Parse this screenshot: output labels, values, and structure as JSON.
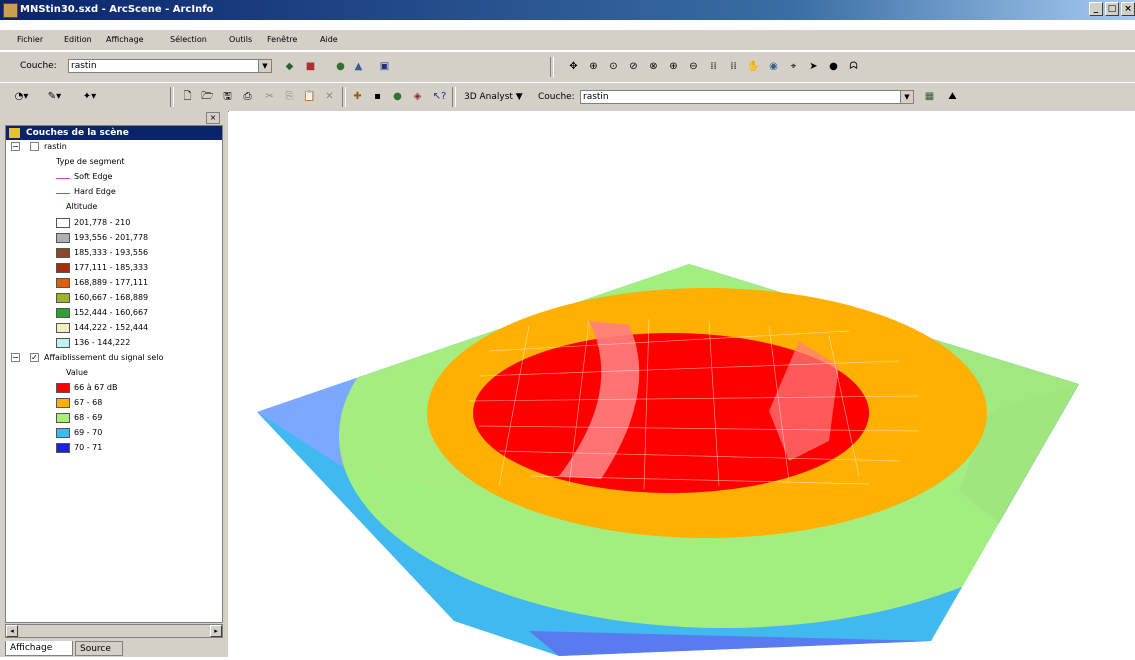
{
  "window": {
    "title": "MNStin30.sxd - ArcScene - ArcInfo",
    "min": "_",
    "max": "□",
    "close": "×"
  },
  "menu": [
    "Fichier",
    "Edition",
    "Affichage",
    "Sélection",
    "Outils",
    "Fenêtre",
    "Aide"
  ],
  "toolbar": {
    "layer_label": "Couche:",
    "layer_value": "rastin",
    "analyst_label": "3D Analyst ▼",
    "layer_label2": "Couche:",
    "layer_value2": "rastin"
  },
  "toc": {
    "title": "Couches de la scène",
    "layer1": {
      "name": "rastin",
      "segment_heading": "Type de segment",
      "segments": [
        {
          "label": "Soft Edge",
          "color": "#c050c0"
        },
        {
          "label": "Hard Edge",
          "color": "#e04040"
        }
      ],
      "altitude_heading": "Altitude",
      "classes": [
        {
          "label": "201,778 - 210",
          "color": "#ffffff"
        },
        {
          "label": "193,556 - 201,778",
          "color": "#b0b0b0"
        },
        {
          "label": "185,333 - 193,556",
          "color": "#8a4a2a"
        },
        {
          "label": "177,111 - 185,333",
          "color": "#a03010"
        },
        {
          "label": "168,889 - 177,111",
          "color": "#d86010"
        },
        {
          "label": "160,667 - 168,889",
          "color": "#a0b030"
        },
        {
          "label": "152,444 - 160,667",
          "color": "#30a030"
        },
        {
          "label": "144,222 - 152,444",
          "color": "#f0f0c0"
        },
        {
          "label": "136 - 144,222",
          "color": "#c0f0f0"
        }
      ]
    },
    "layer2": {
      "name": "Affaiblissement du signal selo",
      "heading": "Value",
      "classes": [
        {
          "label": "66 à 67 dB",
          "color": "#ff0000"
        },
        {
          "label": "67 - 68",
          "color": "#ffb000"
        },
        {
          "label": "68 - 69",
          "color": "#a8f07a"
        },
        {
          "label": "69 - 70",
          "color": "#40b8f0"
        },
        {
          "label": "70 - 71",
          "color": "#2020e0"
        }
      ]
    }
  },
  "tabs": {
    "display": "Affichage",
    "source": "Source"
  }
}
